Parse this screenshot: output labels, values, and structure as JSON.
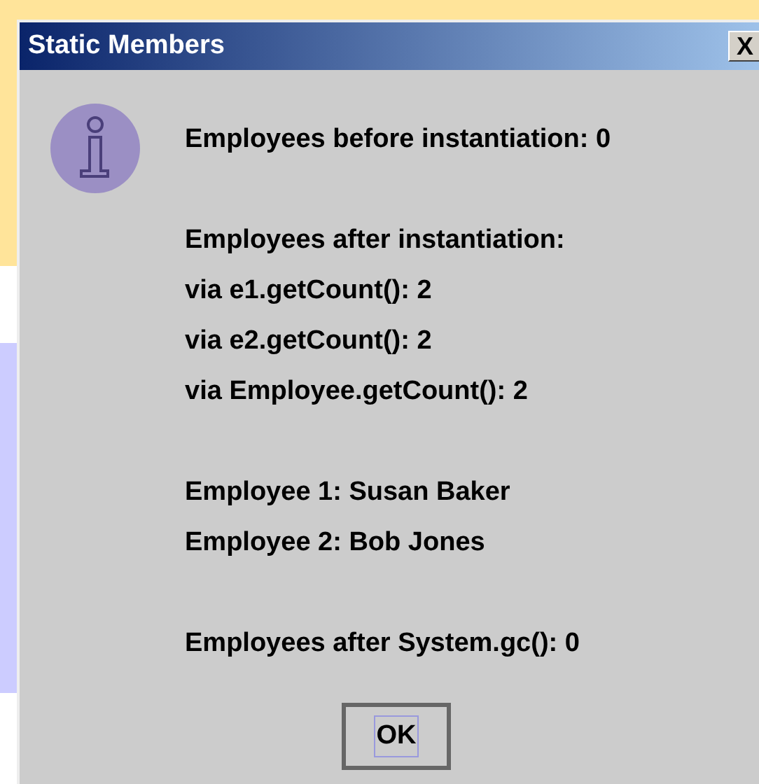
{
  "window": {
    "title": "Static Members",
    "close": "X"
  },
  "message_groups": [
    [
      "Employees before instantiation: 0"
    ],
    [
      "Employees after instantiation:",
      "via e1.getCount(): 2",
      "via e2.getCount(): 2",
      "via Employee.getCount(): 2"
    ],
    [
      "Employee 1: Susan Baker",
      "Employee 2: Bob Jones"
    ],
    [
      "Employees after System.gc(): 0"
    ]
  ],
  "buttons": [
    {
      "label": "OK",
      "focused": true
    }
  ]
}
